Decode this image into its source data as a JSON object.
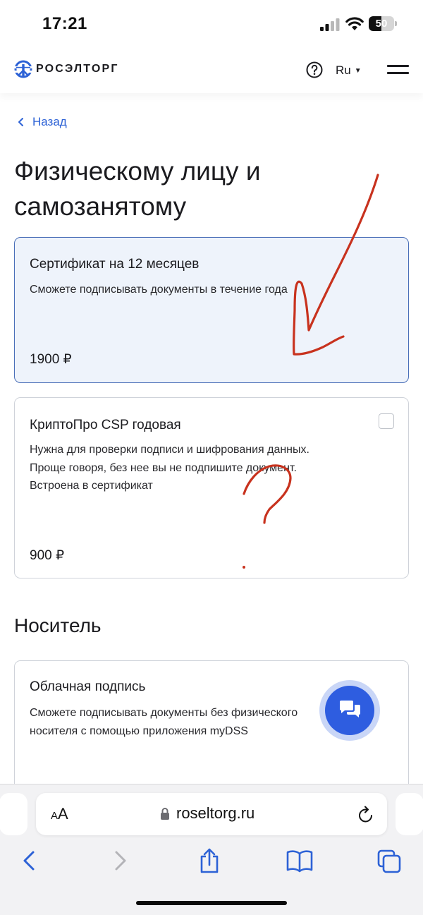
{
  "status_bar": {
    "time": "17:21",
    "battery": "50",
    "battery_level": 0.5
  },
  "header": {
    "logo_text": "РОСЭЛТОРГ",
    "language": "Ru"
  },
  "nav": {
    "back_label": "Назад"
  },
  "page": {
    "title": "Физическому лицу и самозанятому"
  },
  "cards": [
    {
      "title": "Сертификат на 12 месяцев",
      "description": "Сможете подписывать документы в течение года",
      "price": "1900 ₽",
      "selected": true
    },
    {
      "title": "КриптоПро CSP годовая",
      "description": "Нужна для проверки подписи и шифрования данных. Проще говоря, без нее вы не подпишите документ. Встроена в сертификат",
      "price": "900 ₽",
      "selected": false
    }
  ],
  "media_section": {
    "title": "Носитель",
    "card": {
      "title": "Облачная подпись",
      "description": "Сможете подписывать документы без физического носителя с помощью приложения myDSS"
    }
  },
  "browser": {
    "text_size_label": "AA",
    "url": "roseltorg.ru"
  },
  "colors": {
    "accent": "#2d62d6",
    "selected_bg": "#eef3fb",
    "selected_border": "#4a6fb8",
    "annotation": "#c8321e"
  }
}
